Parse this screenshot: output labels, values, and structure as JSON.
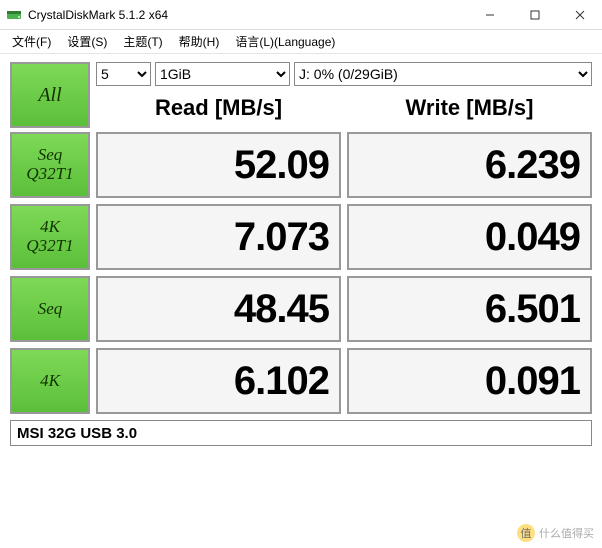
{
  "window": {
    "title": "CrystalDiskMark 5.1.2 x64"
  },
  "menu": {
    "file": "文件(F)",
    "settings": "设置(S)",
    "theme": "主题(T)",
    "help": "帮助(H)",
    "language": "语言(L)(Language)"
  },
  "controls": {
    "all_label": "All",
    "runs": "5",
    "size": "1GiB",
    "drive": "J: 0% (0/29GiB)"
  },
  "headers": {
    "read": "Read [MB/s]",
    "write": "Write [MB/s]"
  },
  "tests": [
    {
      "label": "Seq\nQ32T1",
      "read": "52.09",
      "write": "6.239"
    },
    {
      "label": "4K\nQ32T1",
      "read": "7.073",
      "write": "0.049"
    },
    {
      "label": "Seq",
      "read": "48.45",
      "write": "6.501"
    },
    {
      "label": "4K",
      "read": "6.102",
      "write": "0.091"
    }
  ],
  "footer": {
    "device": "MSI 32G USB 3.0"
  },
  "watermark": {
    "text": "什么值得买"
  }
}
